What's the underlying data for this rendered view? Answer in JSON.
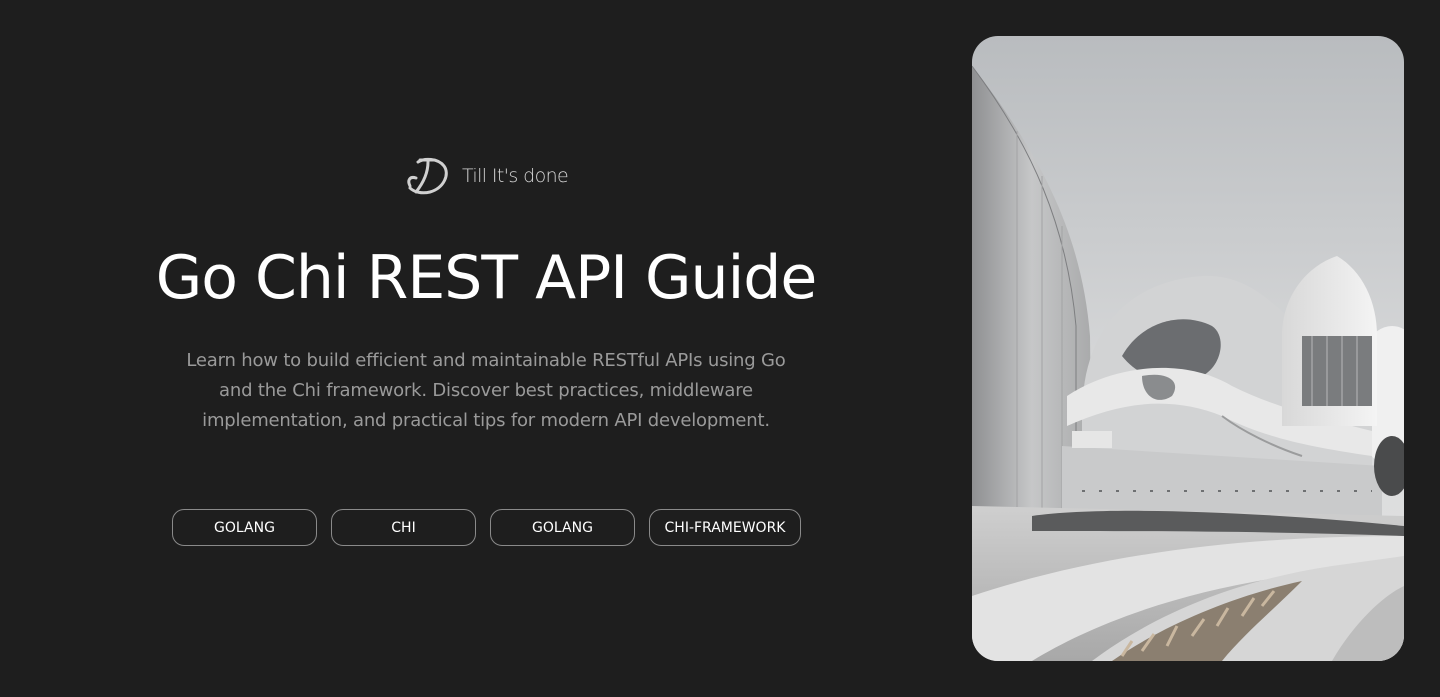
{
  "brand": {
    "name": "Till It's done",
    "logo_icon": "td-monogram-icon"
  },
  "hero": {
    "title": "Go Chi REST API Guide",
    "description": "Learn how to build efficient and maintainable RESTful APIs using Go and the Chi framework. Discover best practices, middleware implementation, and practical tips for modern API development."
  },
  "tags": [
    {
      "label": "GOLANG"
    },
    {
      "label": "CHI"
    },
    {
      "label": "GOLANG"
    },
    {
      "label": "CHI-FRAMEWORK"
    }
  ],
  "image": {
    "subject": "modern white curved architecture building, grayscale"
  },
  "colors": {
    "background": "#1e1e1e",
    "title": "#ffffff",
    "description": "#9a9a9a",
    "tag_border": "#8a8a8a"
  }
}
